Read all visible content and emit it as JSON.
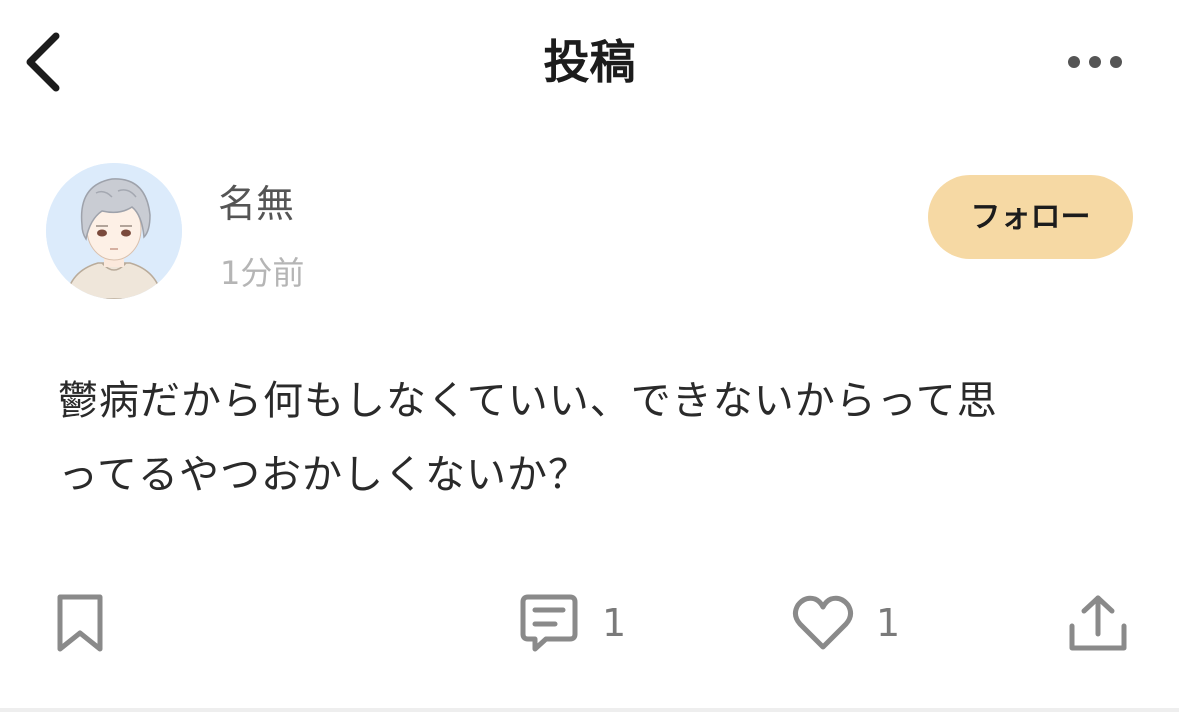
{
  "header": {
    "title": "投稿",
    "back_icon": "chevron-left-icon",
    "more_icon": "more-horizontal-icon"
  },
  "author": {
    "name": "名無",
    "time": "1分前",
    "avatar": "avatar-illustration"
  },
  "follow_button": {
    "label": "フォロー",
    "color": "#f6d9a4"
  },
  "post": {
    "text": "鬱病だから何もしなくていい、できないからって思\nってるやつおかしくないか？"
  },
  "actions": {
    "bookmark_icon": "bookmark-icon",
    "comment_icon": "comment-icon",
    "comment_count": "1",
    "like_icon": "heart-icon",
    "like_count": "1",
    "share_icon": "share-icon"
  },
  "colors": {
    "icon_gray": "#8a8a8a",
    "follow_bg": "#f6d9a4",
    "timestamp": "#b5b5b5"
  }
}
